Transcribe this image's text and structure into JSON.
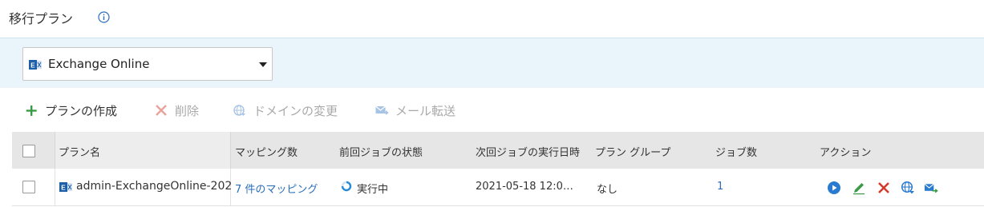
{
  "header": {
    "title": "移行プラン",
    "info_icon": "info-icon"
  },
  "source": {
    "selected": "Exchange Online",
    "icon": "exchange-icon"
  },
  "toolbar": {
    "create": "プランの作成",
    "delete": "削除",
    "change_domain": "ドメインの変更",
    "mail_forward": "メール転送"
  },
  "table": {
    "columns": {
      "name": "プラン名",
      "mappings": "マッピング数",
      "last_job": "前回ジョブの状態",
      "next_job": "次回ジョブの実行日時",
      "plan_group": "プラン グループ",
      "job_count": "ジョブ数",
      "actions": "アクション"
    },
    "rows": [
      {
        "name": "admin-ExchangeOnline-202",
        "mappings": "7 件のマッピング",
        "last_job": "実行中",
        "next_job": "2021-05-18 12:0…",
        "plan_group": "なし",
        "job_count": "1"
      }
    ]
  },
  "colors": {
    "accent": "#2a6ebb",
    "create_green": "#3a9a45",
    "delete_red": "#d33a2c",
    "panel_bg": "#e9f4fb",
    "header_bg": "#e6e6e6"
  }
}
